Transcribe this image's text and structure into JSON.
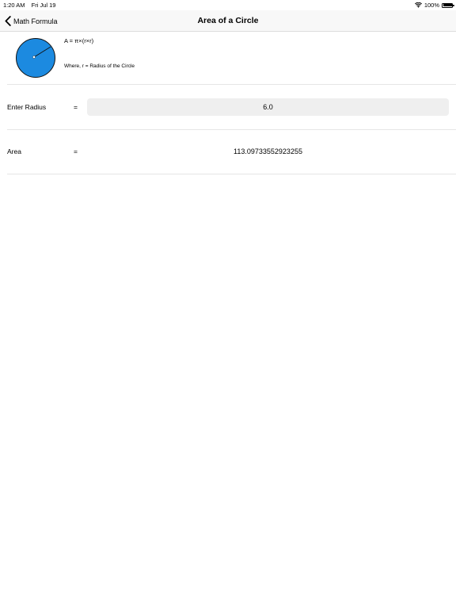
{
  "status_bar": {
    "time": "1:20 AM",
    "date": "Fri Jul 19",
    "battery_percent": "100%",
    "icons": [
      "wifi-icon",
      "battery-icon"
    ]
  },
  "nav": {
    "back_label": "Math Formula",
    "back_icon": "chevron-left-icon",
    "title": "Area of a Circle"
  },
  "formula": {
    "equation": "A = π×(r×r)",
    "where": "Where, r = Radius of the Circle",
    "circle_color": "#1c8ae0"
  },
  "input": {
    "label": "Enter Radius",
    "equals": "=",
    "value": "6.0"
  },
  "result": {
    "label": "Area",
    "equals": "=",
    "value": "113.09733552923255"
  }
}
